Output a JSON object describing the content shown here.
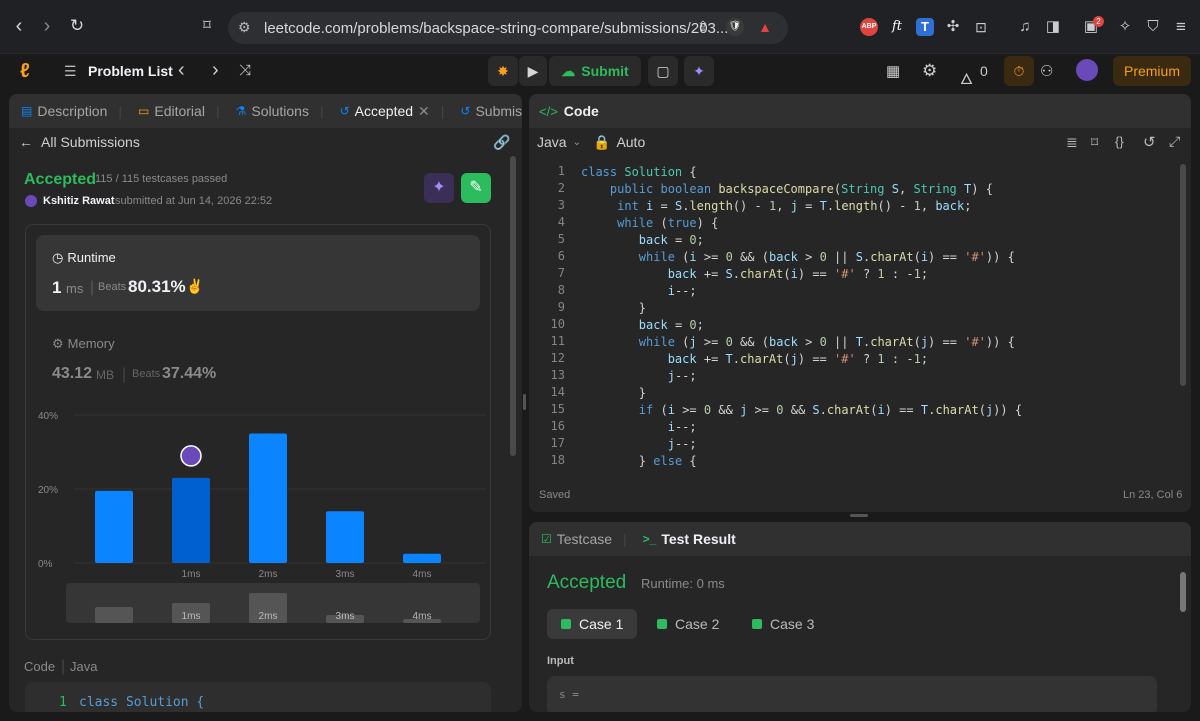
{
  "browser": {
    "url": "leetcode.com/problems/backspace-string-compare/submissions/203...",
    "ext_abp": "ABP",
    "ext_ft": "ft",
    "ext_t": "T",
    "ext_badge": "2"
  },
  "header": {
    "problem_list": "Problem List",
    "submit": "Submit",
    "streak": "0",
    "premium": "Premium"
  },
  "left_tabs": [
    "Description",
    "Editorial",
    "Solutions",
    "Accepted",
    "Submissions"
  ],
  "submission": {
    "back_label": "All Submissions",
    "status": "Accepted",
    "testcases": "115 / 115 testcases passed",
    "author": "Kshitiz Rawat",
    "submitted": "submitted at Jun 14, 2026 22:52",
    "runtime_title": "Runtime",
    "runtime_value": "1",
    "runtime_unit": "ms",
    "beats_label": "Beats",
    "runtime_beats": "80.31%",
    "memory_title": "Memory",
    "memory_value": "43.12",
    "memory_unit": "MB",
    "memory_beats": "37.44%",
    "code_label": "Code",
    "code_lang": "Java",
    "preview_line_no": "1",
    "preview_code": "class Solution {"
  },
  "chart_data": {
    "type": "bar",
    "y_ticks": [
      "40%",
      "20%",
      "0%"
    ],
    "ylim": [
      0,
      40
    ],
    "bars": [
      {
        "label": "",
        "value": 19.5
      },
      {
        "label": "1ms",
        "value": 23,
        "highlight": true
      },
      {
        "label": "2ms",
        "value": 35
      },
      {
        "label": "3ms",
        "value": 14
      },
      {
        "label": "4ms",
        "value": 2.5
      }
    ],
    "mini_labels": [
      "1ms",
      "2ms",
      "3ms",
      "4ms"
    ],
    "bar_color": "#0a84ff",
    "highlight_color": "#0060d0"
  },
  "code_panel": {
    "title": "Code",
    "language": "Java",
    "mode": "Auto",
    "status": "Saved",
    "cursor": "Ln 23, Col 6",
    "lines": [
      "class Solution {",
      "    public boolean backspaceCompare(String S, String T) {",
      "     int i = S.length() - 1, j = T.length() - 1, back;",
      "     while (true) {",
      "        back = 0;",
      "        while (i >= 0 && (back > 0 || S.charAt(i) == '#')) {",
      "            back += S.charAt(i) == '#' ? 1 : -1;",
      "            i--;",
      "        }",
      "        back = 0;",
      "        while (j >= 0 && (back > 0 || T.charAt(j) == '#')) {",
      "            back += T.charAt(j) == '#' ? 1 : -1;",
      "            j--;",
      "        }",
      "        if (i >= 0 && j >= 0 && S.charAt(i) == T.charAt(j)) {",
      "            i--;",
      "            j--;",
      "        } else {"
    ]
  },
  "result_panel": {
    "tab_testcase": "Testcase",
    "tab_result": "Test Result",
    "status": "Accepted",
    "runtime": "Runtime: 0 ms",
    "cases": [
      "Case 1",
      "Case 2",
      "Case 3"
    ],
    "input_label": "Input",
    "input_value": "s ="
  }
}
